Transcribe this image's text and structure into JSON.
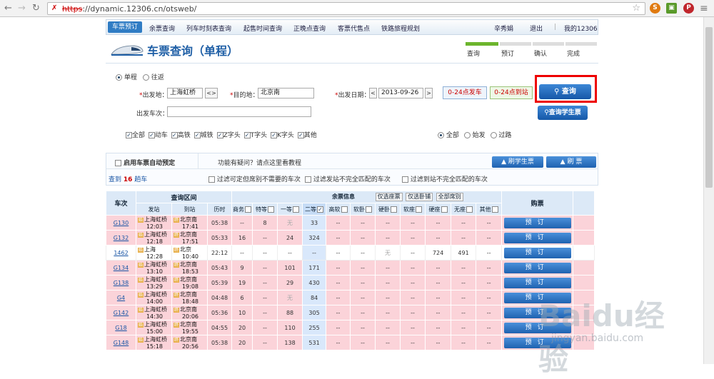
{
  "browser": {
    "url_strike": "https",
    "url_rest": "://dynamic.12306.cn/otsweb/"
  },
  "nav": {
    "active": "车票预订",
    "items": [
      "余票查询",
      "列车时刻表查询",
      "起售时间查询",
      "正晚点查询",
      "客票代售点",
      "铁路旅程规划"
    ],
    "user": "辛秀娟",
    "logout": "退出",
    "my": "我的12306"
  },
  "page": {
    "title": "车票查询（单程）",
    "steps": [
      "查询",
      "预订",
      "确认",
      "完成"
    ]
  },
  "form": {
    "one_way": "单程",
    "round_trip": "往返",
    "from_label": "出发地：",
    "from_value": "上海虹桥",
    "swap": "<>",
    "to_label": "目的地：",
    "to_value": "北京南",
    "date_label": "出发日期：",
    "date_value": "2013-09-26",
    "prev": "<",
    "next": ">",
    "depart_range": "0-24点发车",
    "arrive_range": "0-24点到站",
    "query_btn": "查询",
    "student_btn": "查询学生票",
    "train_label": "出发车次：",
    "types": [
      "全部",
      "动车",
      "高铁",
      "城铁",
      "Z字头",
      "T字头",
      "K字头",
      "其他"
    ],
    "filter_all": "全部",
    "filter_start": "始发",
    "filter_pass": "过路"
  },
  "opts": {
    "auto": "启用车票自动预定",
    "help": "功能有疑问？请点这里看教程",
    "refresh_student": "刷学生票",
    "refresh": "刷 票",
    "found_pre": "查到",
    "found_count": "16",
    "found_post": "趟车",
    "f1": "过滤可定但席别不需要的车次",
    "f2": "过滤发站不完全匹配的车次",
    "f3": "过滤到站不完全匹配的车次"
  },
  "table": {
    "h": {
      "train": "车次",
      "range": "查询区间",
      "from": "发站",
      "to": "到站",
      "dur": "历时",
      "remain": "余票信息",
      "only_seat": "仅选座票",
      "only_sleeper": "仅选卧铺",
      "all_seat": "全部席别",
      "buy": "购票"
    },
    "classes": [
      "商务",
      "特等",
      "一等",
      "二等",
      "高软",
      "软卧",
      "硬卧",
      "软座",
      "硬座",
      "无座",
      "其他"
    ],
    "book": "预订",
    "rows": [
      {
        "no": "G130",
        "from": "上海虹桥",
        "dep": "12:03",
        "to": "北京南",
        "arr": "17:41",
        "dur": "05:38",
        "seats": [
          "--",
          "8",
          "无",
          "33",
          "--",
          "--",
          "--",
          "--",
          "--",
          "--",
          "--"
        ]
      },
      {
        "no": "G132",
        "from": "上海虹桥",
        "dep": "12:18",
        "to": "北京南",
        "arr": "17:51",
        "dur": "05:33",
        "seats": [
          "16",
          "--",
          "24",
          "324",
          "--",
          "--",
          "--",
          "--",
          "--",
          "--",
          "--"
        ]
      },
      {
        "no": "1462",
        "from": "上海",
        "dep": "12:28",
        "to": "北京",
        "arr": "10:40",
        "dur": "22:12",
        "seats": [
          "--",
          "--",
          "--",
          "--",
          "--",
          "--",
          "无",
          "--",
          "724",
          "491",
          "--"
        ]
      },
      {
        "no": "G134",
        "from": "上海虹桥",
        "dep": "13:10",
        "to": "北京南",
        "arr": "18:53",
        "dur": "05:43",
        "seats": [
          "9",
          "--",
          "101",
          "171",
          "--",
          "--",
          "--",
          "--",
          "--",
          "--",
          "--"
        ]
      },
      {
        "no": "G138",
        "from": "上海虹桥",
        "dep": "13:29",
        "to": "北京南",
        "arr": "19:08",
        "dur": "05:39",
        "seats": [
          "19",
          "--",
          "29",
          "430",
          "--",
          "--",
          "--",
          "--",
          "--",
          "--",
          "--"
        ]
      },
      {
        "no": "G4",
        "from": "上海虹桥",
        "dep": "14:00",
        "to": "北京南",
        "arr": "18:48",
        "dur": "04:48",
        "seats": [
          "6",
          "--",
          "无",
          "84",
          "--",
          "--",
          "--",
          "--",
          "--",
          "--",
          "--"
        ]
      },
      {
        "no": "G142",
        "from": "上海虹桥",
        "dep": "14:30",
        "to": "北京南",
        "arr": "20:06",
        "dur": "05:36",
        "seats": [
          "10",
          "--",
          "88",
          "305",
          "--",
          "--",
          "--",
          "--",
          "--",
          "--",
          "--"
        ]
      },
      {
        "no": "G18",
        "from": "上海虹桥",
        "dep": "15:00",
        "to": "北京南",
        "arr": "19:55",
        "dur": "04:55",
        "seats": [
          "20",
          "--",
          "110",
          "255",
          "--",
          "--",
          "--",
          "--",
          "--",
          "--",
          "--"
        ]
      },
      {
        "no": "G148",
        "from": "上海虹桥",
        "dep": "15:18",
        "to": "北京南",
        "arr": "20:56",
        "dur": "05:38",
        "seats": [
          "20",
          "--",
          "138",
          "531",
          "--",
          "--",
          "--",
          "--",
          "--",
          "--",
          "--"
        ]
      }
    ]
  },
  "watermark": {
    "main": "Baidu经验",
    "sub": "jingyan.baidu.com"
  }
}
